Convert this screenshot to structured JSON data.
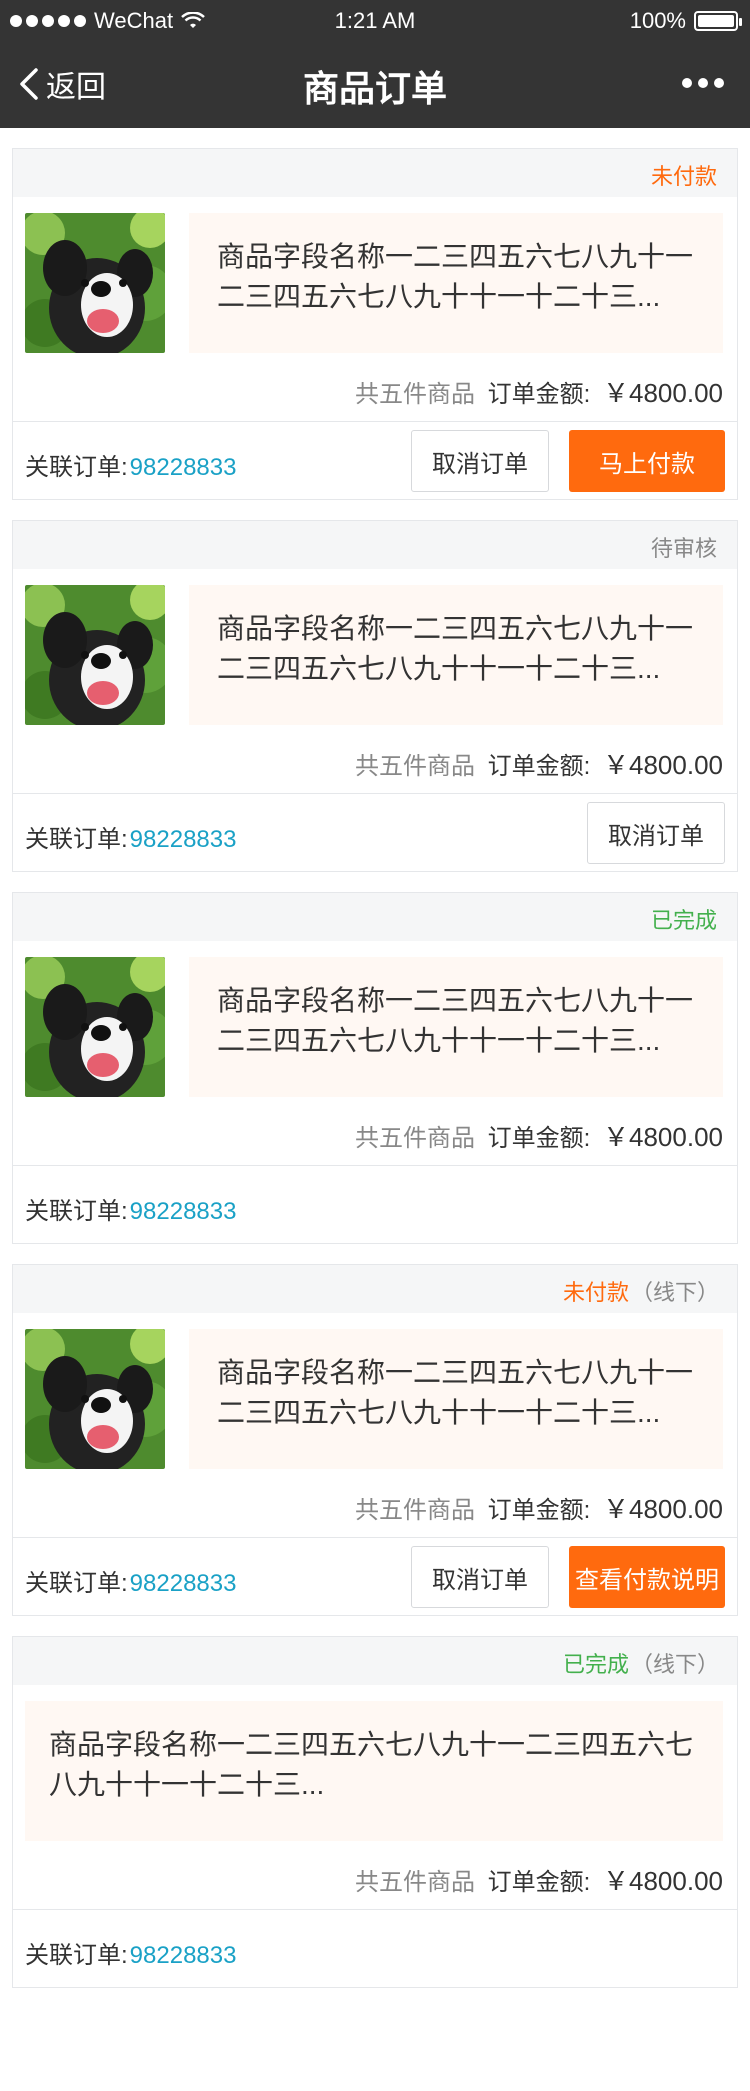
{
  "status_bar": {
    "carrier": "WeChat",
    "time": "1:21 AM",
    "battery": "100%"
  },
  "nav": {
    "back_label": "返回",
    "title": "商品订单"
  },
  "labels": {
    "summary_count": "共五件商品",
    "summary_amount_label": "订单金额:",
    "related_order_label": "关联订单:"
  },
  "colors": {
    "accent_orange": "#ff6a0e",
    "link_blue": "#1aa1c6",
    "success_green": "#43b04d"
  },
  "orders": [
    {
      "status": "未付款",
      "status_note": "",
      "product_name": "商品字段名称一二三四五六七八九十一二三四五六七八九十十一十二十三...",
      "amount": "￥4800.00",
      "order_no": "98228833",
      "buttons": [
        "取消订单",
        "马上付款"
      ]
    },
    {
      "status": "待审核",
      "status_note": "",
      "product_name": "商品字段名称一二三四五六七八九十一二三四五六七八九十十一十二十三...",
      "amount": "￥4800.00",
      "order_no": "98228833",
      "buttons": [
        "取消订单"
      ]
    },
    {
      "status": "已完成",
      "status_note": "",
      "product_name": "商品字段名称一二三四五六七八九十一二三四五六七八九十十一十二十三...",
      "amount": "￥4800.00",
      "order_no": "98228833",
      "buttons": []
    },
    {
      "status": "未付款",
      "status_note": "（线下）",
      "product_name": "商品字段名称一二三四五六七八九十一二三四五六七八九十十一十二十三...",
      "amount": "￥4800.00",
      "order_no": "98228833",
      "buttons": [
        "取消订单",
        "查看付款说明"
      ]
    },
    {
      "status": "已完成",
      "status_note": "（线下）",
      "product_name": "商品字段名称一二三四五六七八九十一二三四五六七八九十十一十二十三...",
      "amount": "￥4800.00",
      "order_no": "98228833",
      "buttons": []
    }
  ]
}
